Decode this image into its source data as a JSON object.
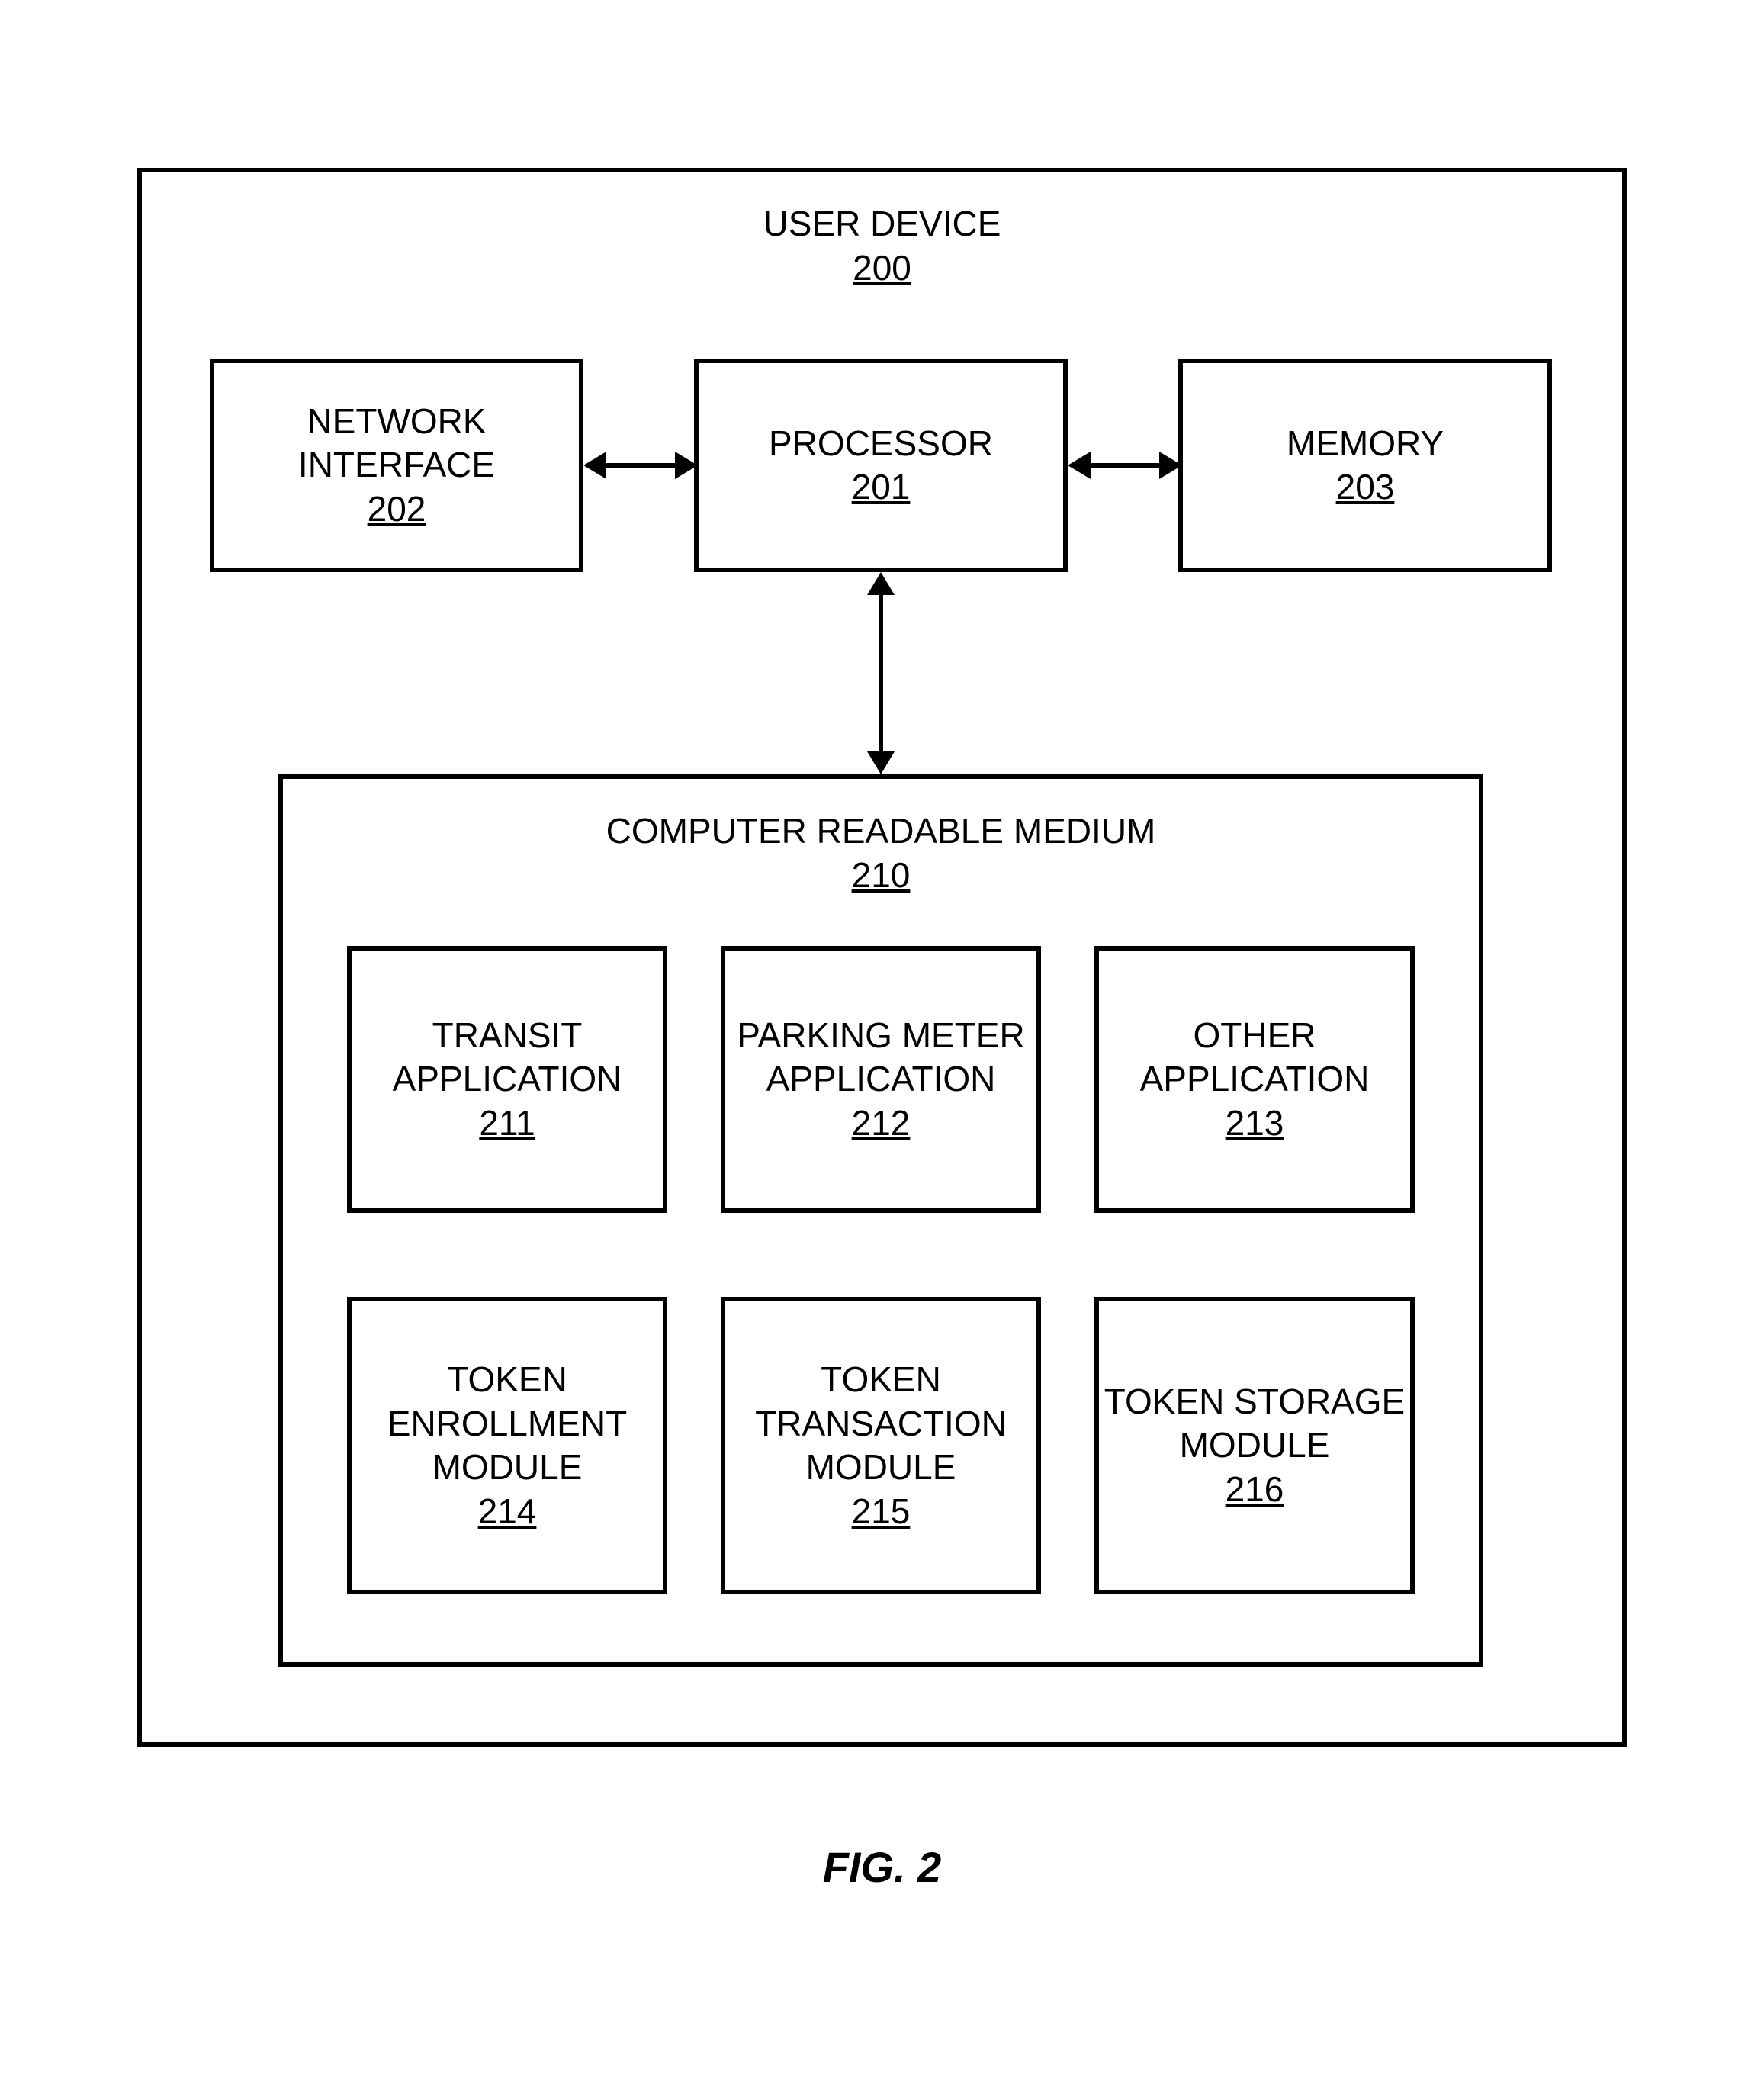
{
  "diagram": {
    "title": "USER DEVICE",
    "title_ref": "200",
    "network_interface": {
      "label1": "NETWORK",
      "label2": "INTERFACE",
      "ref": "202"
    },
    "processor": {
      "label": "PROCESSOR",
      "ref": "201"
    },
    "memory": {
      "label": "MEMORY",
      "ref": "203"
    },
    "crm": {
      "label": "COMPUTER READABLE MEDIUM",
      "ref": "210",
      "transit_app": {
        "label1": "TRANSIT",
        "label2": "APPLICATION",
        "ref": "211"
      },
      "parking_app": {
        "label1": "PARKING METER",
        "label2": "APPLICATION",
        "ref": "212"
      },
      "other_app": {
        "label1": "OTHER",
        "label2": "APPLICATION",
        "ref": "213"
      },
      "token_enroll": {
        "label1": "TOKEN",
        "label2": "ENROLLMENT",
        "label3": "MODULE",
        "ref": "214"
      },
      "token_trans": {
        "label1": "TOKEN",
        "label2": "TRANSACTION",
        "label3": "MODULE",
        "ref": "215"
      },
      "token_storage": {
        "label1": "TOKEN STORAGE",
        "label2": "MODULE",
        "ref": "216"
      }
    },
    "figure_label": "FIG. 2"
  }
}
